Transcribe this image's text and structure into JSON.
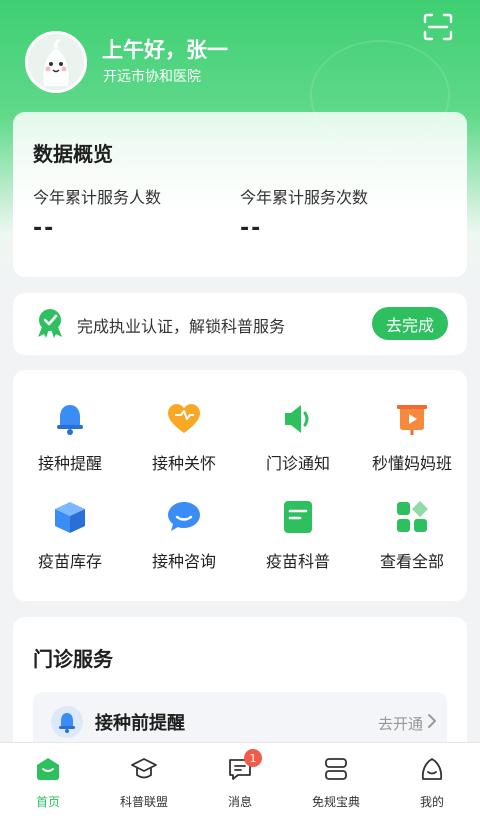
{
  "header": {
    "greeting": "上午好，张一",
    "hospital": "开远市协和医院"
  },
  "overview": {
    "title": "数据概览",
    "stats": [
      {
        "label": "今年累计服务人数",
        "value": "--"
      },
      {
        "label": "今年累计服务次数",
        "value": "--"
      }
    ]
  },
  "certification": {
    "text": "完成执业认证，解锁科普服务",
    "button": "去完成"
  },
  "grid": {
    "items": [
      {
        "label": "接种提醒",
        "icon": "bell-icon"
      },
      {
        "label": "接种关怀",
        "icon": "heart-icon"
      },
      {
        "label": "门诊通知",
        "icon": "speaker-icon"
      },
      {
        "label": "秒懂妈妈班",
        "icon": "video-board-icon"
      },
      {
        "label": "疫苗库存",
        "icon": "box-icon"
      },
      {
        "label": "接种咨询",
        "icon": "chat-bubble-icon"
      },
      {
        "label": "疫苗科普",
        "icon": "document-icon"
      },
      {
        "label": "查看全部",
        "icon": "grid-apps-icon"
      }
    ]
  },
  "services": {
    "title": "门诊服务",
    "rows": [
      {
        "label": "接种前提醒",
        "action": "去开通",
        "icon": "bell-icon"
      }
    ]
  },
  "tabbar": {
    "items": [
      {
        "label": "首页",
        "icon": "home-icon",
        "active": true
      },
      {
        "label": "科普联盟",
        "icon": "graduation-cap-icon",
        "active": false
      },
      {
        "label": "消息",
        "icon": "message-icon",
        "active": false,
        "badge": "1"
      },
      {
        "label": "免规宝典",
        "icon": "stack-icon",
        "active": false
      },
      {
        "label": "我的",
        "icon": "profile-icon",
        "active": false
      }
    ]
  },
  "colors": {
    "brand_green": "#2ec05f",
    "hero_green": "#3fcf73",
    "badge_red": "#f05b4a"
  }
}
